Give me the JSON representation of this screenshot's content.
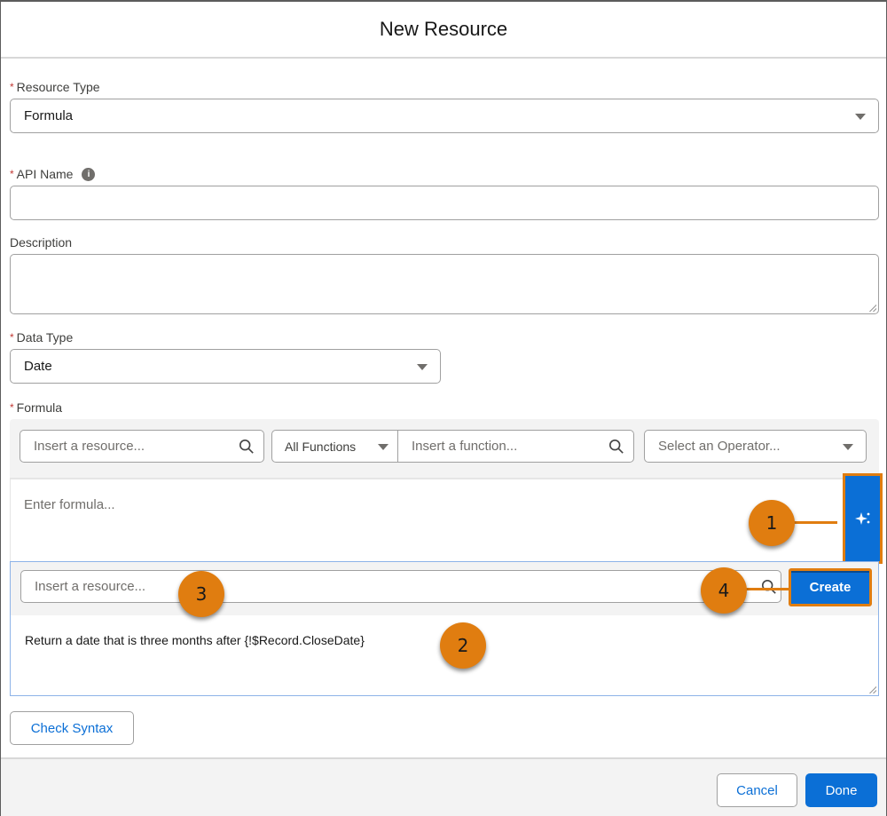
{
  "modal": {
    "title": "New Resource"
  },
  "fields": {
    "resource_type": {
      "label": "Resource Type",
      "required": "*",
      "value": "Formula"
    },
    "api_name": {
      "label": "API Name",
      "required": "*",
      "value": "",
      "info_icon": "info-icon"
    },
    "description": {
      "label": "Description",
      "value": ""
    },
    "data_type": {
      "label": "Data Type",
      "required": "*",
      "value": "Date"
    },
    "formula": {
      "label": "Formula",
      "required": "*"
    }
  },
  "formula_toolbar": {
    "resource_placeholder": "Insert a resource...",
    "functions_filter": "All Functions",
    "function_placeholder": "Insert a function...",
    "operator_placeholder": "Select an Operator..."
  },
  "formula_editor": {
    "placeholder": "Enter formula...",
    "value": ""
  },
  "ai_assist": {
    "button_icon": "sparkles-icon",
    "resource_placeholder": "Insert a resource...",
    "create_label": "Create",
    "prompt_text": "Return a date that is three months after {!$Record.CloseDate}"
  },
  "callouts": [
    "1",
    "2",
    "3",
    "4"
  ],
  "buttons": {
    "check_syntax": "Check Syntax",
    "cancel": "Cancel",
    "done": "Done"
  },
  "colors": {
    "brand_blue": "#0b6fd6",
    "callout_orange": "#e07d10",
    "required_red": "#c23934"
  }
}
